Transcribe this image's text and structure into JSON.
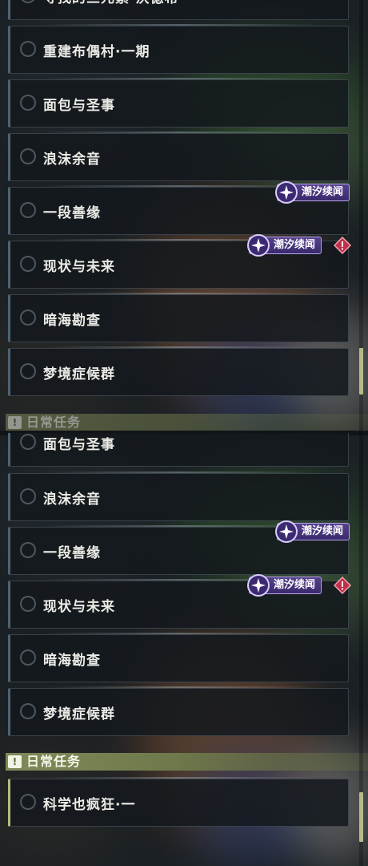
{
  "top_list": {
    "partial_first": "寻找的三元素·沃德希",
    "items": [
      {
        "label": "重建布偶村·一期"
      },
      {
        "label": "面包与圣事"
      },
      {
        "label": "浪沫余音"
      },
      {
        "label": "一段善缘",
        "badge": "潮汐续闻"
      },
      {
        "label": "现状与未来",
        "badge": "潮汐续闻",
        "alert": true
      },
      {
        "label": "暗海勘查"
      },
      {
        "label": "梦境症候群"
      }
    ],
    "partial_header": "日常任务"
  },
  "bottom_list": {
    "items": [
      {
        "label": "面包与圣事"
      },
      {
        "label": "浪沫余音"
      },
      {
        "label": "一段善缘",
        "badge": "潮汐续闻"
      },
      {
        "label": "现状与未来",
        "badge": "潮汐续闻",
        "alert": true
      },
      {
        "label": "暗海勘查"
      },
      {
        "label": "梦境症候群"
      }
    ],
    "daily_header": {
      "icon": "!",
      "title": "日常任务"
    },
    "daily_items": [
      {
        "label": "科学也疯狂·一"
      }
    ]
  },
  "colors": {
    "badge_purple": "#4a3680",
    "daily_header_green": "#7f8a58",
    "alert_red": "#c0304a",
    "scroll_thumb": "#b7b98a"
  },
  "icons": {
    "quest_status": "circle-icon",
    "badge": "sparkle-moon-icon",
    "alert": "red-diamond-alert-icon",
    "daily": "exclamation-square-icon"
  }
}
